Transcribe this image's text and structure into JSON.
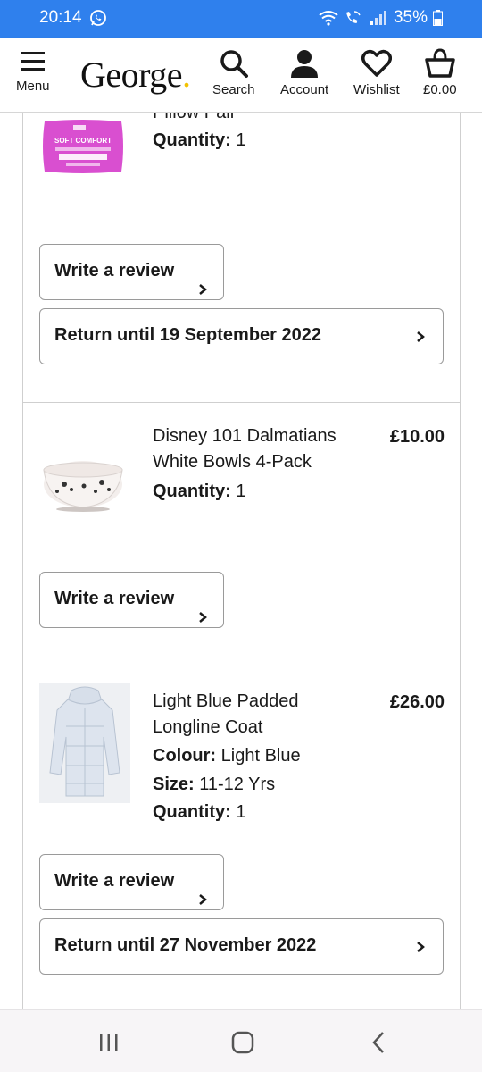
{
  "status_bar": {
    "time": "20:14",
    "battery": "35%"
  },
  "header": {
    "menu_label": "Menu",
    "logo_text": "George",
    "logo_dot": ".",
    "search_label": "Search",
    "account_label": "Account",
    "wishlist_label": "Wishlist",
    "bag_label": "£0.00"
  },
  "items": [
    {
      "title": "Pillow Pair",
      "quantity_label": "Quantity:",
      "quantity": " 1",
      "review_label": "Write a review",
      "return_label": "Return until 19 September 2022",
      "image_text": "SOFT COMFORT"
    },
    {
      "title": "Disney 101 Dalmatians White Bowls 4-Pack",
      "price": "£10.00",
      "quantity_label": "Quantity:",
      "quantity": " 1",
      "review_label": "Write a review"
    },
    {
      "title": "Light Blue Padded Longline Coat",
      "price": "£26.00",
      "colour_label": "Colour:",
      "colour": " Light Blue",
      "size_label": "Size:",
      "size": " 11-12 Yrs",
      "quantity_label": "Quantity:",
      "quantity": " 1",
      "review_label": "Write a review",
      "return_label": "Return until 27 November 2022"
    }
  ],
  "colors": {
    "status_bar": "#2f80ed",
    "logo_dot": "#f2c200"
  }
}
